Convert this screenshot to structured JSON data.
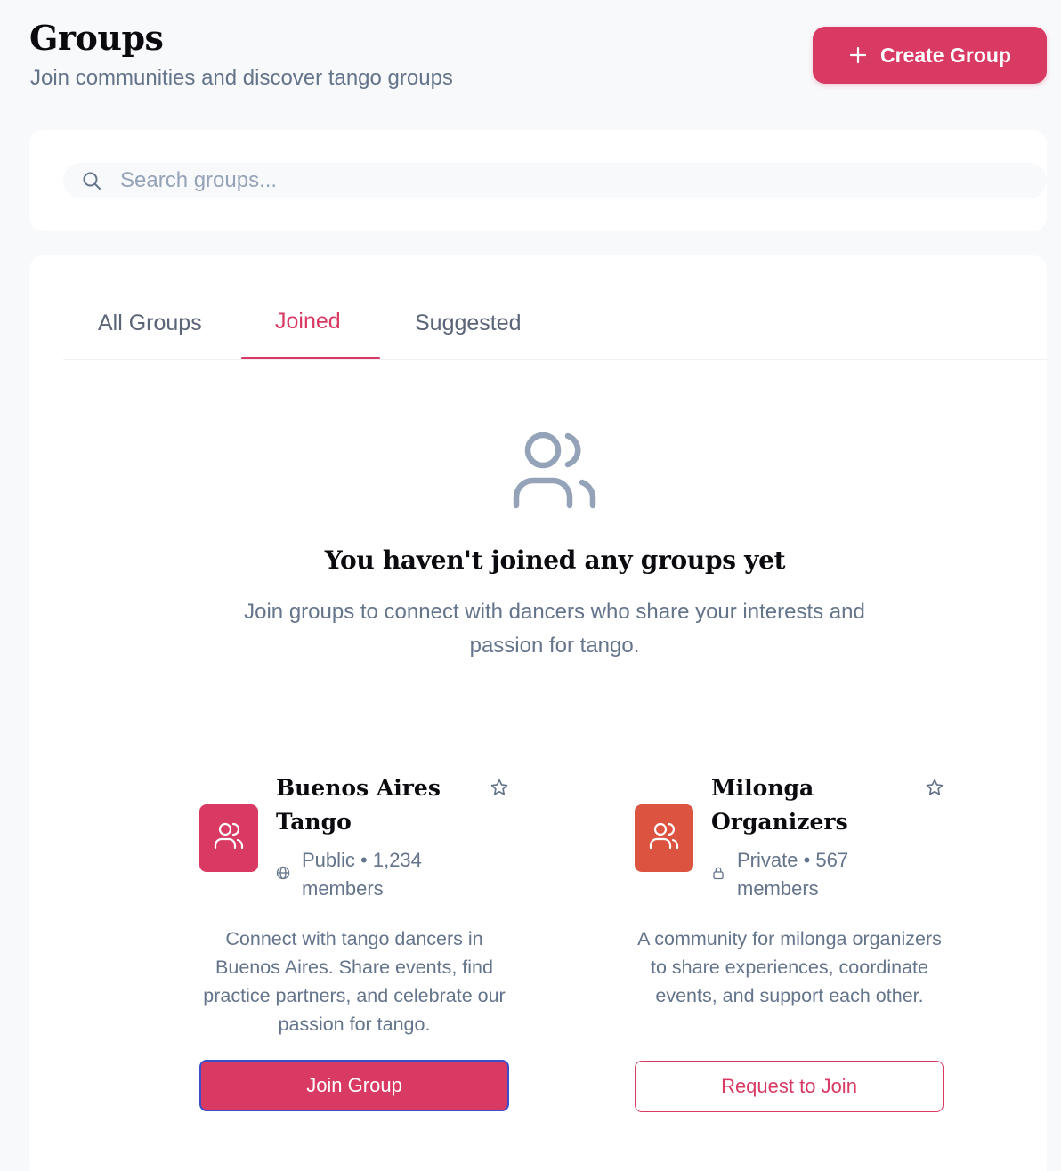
{
  "header": {
    "title": "Groups",
    "subtitle": "Join communities and discover tango groups",
    "create_button_label": "Create Group"
  },
  "search": {
    "placeholder": "Search groups...",
    "value": ""
  },
  "tabs": [
    {
      "label": "All Groups",
      "active": false
    },
    {
      "label": "Joined",
      "active": true
    },
    {
      "label": "Suggested",
      "active": false
    }
  ],
  "empty_state": {
    "icon": "users-icon",
    "title": "You haven't joined any groups yet",
    "description": "Join groups to connect with dancers who share your interests and passion for tango."
  },
  "groups": [
    {
      "name": "Buenos Aires Tango",
      "visibility_icon": "globe-icon",
      "meta": "Public • 1,234 members",
      "description": "Connect with tango dancers in Buenos Aires. Share events, find practice partners, and celebrate our passion for tango.",
      "action_label": "Join Group",
      "avatar_color": "#d93a63"
    },
    {
      "name": "Milonga Organizers",
      "visibility_icon": "lock-icon",
      "meta": "Private • 567 members",
      "description": "A community for milonga organizers to share experiences, coordinate events, and support each other.",
      "action_label": "Request to Join",
      "avatar_color": "#dc5440"
    }
  ],
  "colors": {
    "accent": "#d93a63",
    "avatar_secondary": "#dc5440",
    "muted_text": "#64748b",
    "background": "#f8f9fb"
  }
}
